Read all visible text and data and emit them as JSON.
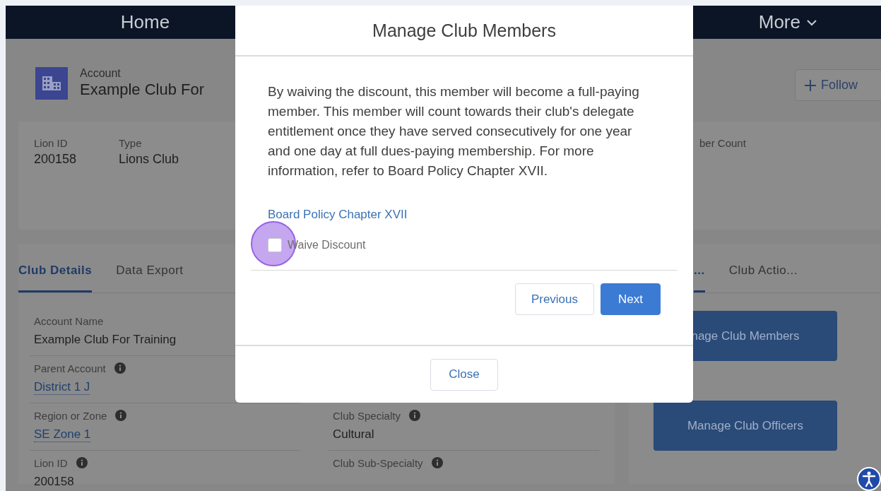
{
  "nav": {
    "items": [
      {
        "label": "Home",
        "dropdown": false
      },
      {
        "label": "More",
        "dropdown": true
      }
    ]
  },
  "record": {
    "object_type": "Account",
    "title": "Example Club For",
    "follow_button": {
      "label": "Follow"
    }
  },
  "highlights": [
    {
      "label": "Lion ID",
      "value": "200158"
    },
    {
      "label": "Type",
      "value": "Lions Club"
    },
    {
      "label": "ber Count"
    }
  ],
  "left_tabs": [
    {
      "label": "Club Details",
      "selected": true
    },
    {
      "label": "Data Export",
      "selected": false
    }
  ],
  "details": {
    "left_fields": [
      {
        "label": "Account Name",
        "value": "Example Club For Training",
        "info": false,
        "kind": "text"
      },
      {
        "label": "Parent Account",
        "value": "District 1 J",
        "info": true,
        "kind": "link"
      },
      {
        "label": "Region or Zone",
        "value": "SE Zone 1",
        "info": true,
        "kind": "link"
      },
      {
        "label": "Lion ID",
        "value": "200158",
        "info": true,
        "kind": "text"
      }
    ],
    "right_fields": [
      {
        "label": "Club Specialty",
        "value": "Cultural",
        "info": true,
        "kind": "text"
      },
      {
        "label": "Club Sub-Specialty",
        "info": true
      }
    ]
  },
  "right_tabs": [
    {
      "label": "...",
      "selected": true
    },
    {
      "label": "Club Actio...",
      "selected": false
    }
  ],
  "action_buttons": [
    "nage Club Members",
    "Manage Club Officers"
  ],
  "modal": {
    "title": "Manage Club Members",
    "message": "By waiving the discount, this member will become a full-paying member. This member will count towards their club's delegate entitlement once they have served consecutively for one year and one day at full dues-paying membership. For more information, refer to Board Policy Chapter XVII.",
    "link": "Board Policy Chapter XVII",
    "checkbox": {
      "label": "Waive Discount",
      "checked": false,
      "highlighted": true
    },
    "buttons": [
      {
        "label": "Previous",
        "kind": "neutral"
      },
      {
        "label": "Next",
        "kind": "brand"
      }
    ],
    "close_button": "Close"
  }
}
